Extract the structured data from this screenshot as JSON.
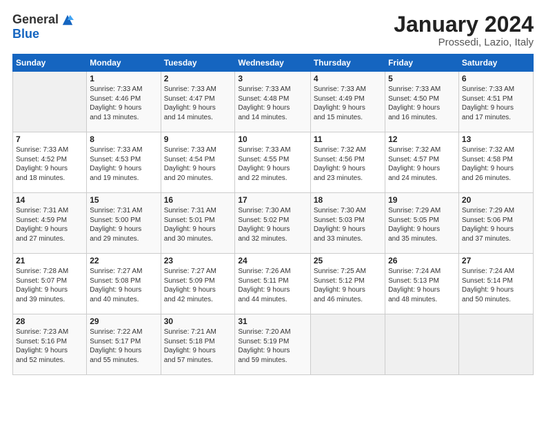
{
  "header": {
    "logo_general": "General",
    "logo_blue": "Blue",
    "title": "January 2024",
    "subtitle": "Prossedi, Lazio, Italy"
  },
  "columns": [
    "Sunday",
    "Monday",
    "Tuesday",
    "Wednesday",
    "Thursday",
    "Friday",
    "Saturday"
  ],
  "weeks": [
    [
      {
        "day": "",
        "info": ""
      },
      {
        "day": "1",
        "info": "Sunrise: 7:33 AM\nSunset: 4:46 PM\nDaylight: 9 hours\nand 13 minutes."
      },
      {
        "day": "2",
        "info": "Sunrise: 7:33 AM\nSunset: 4:47 PM\nDaylight: 9 hours\nand 14 minutes."
      },
      {
        "day": "3",
        "info": "Sunrise: 7:33 AM\nSunset: 4:48 PM\nDaylight: 9 hours\nand 14 minutes."
      },
      {
        "day": "4",
        "info": "Sunrise: 7:33 AM\nSunset: 4:49 PM\nDaylight: 9 hours\nand 15 minutes."
      },
      {
        "day": "5",
        "info": "Sunrise: 7:33 AM\nSunset: 4:50 PM\nDaylight: 9 hours\nand 16 minutes."
      },
      {
        "day": "6",
        "info": "Sunrise: 7:33 AM\nSunset: 4:51 PM\nDaylight: 9 hours\nand 17 minutes."
      }
    ],
    [
      {
        "day": "7",
        "info": "Sunrise: 7:33 AM\nSunset: 4:52 PM\nDaylight: 9 hours\nand 18 minutes."
      },
      {
        "day": "8",
        "info": "Sunrise: 7:33 AM\nSunset: 4:53 PM\nDaylight: 9 hours\nand 19 minutes."
      },
      {
        "day": "9",
        "info": "Sunrise: 7:33 AM\nSunset: 4:54 PM\nDaylight: 9 hours\nand 20 minutes."
      },
      {
        "day": "10",
        "info": "Sunrise: 7:33 AM\nSunset: 4:55 PM\nDaylight: 9 hours\nand 22 minutes."
      },
      {
        "day": "11",
        "info": "Sunrise: 7:32 AM\nSunset: 4:56 PM\nDaylight: 9 hours\nand 23 minutes."
      },
      {
        "day": "12",
        "info": "Sunrise: 7:32 AM\nSunset: 4:57 PM\nDaylight: 9 hours\nand 24 minutes."
      },
      {
        "day": "13",
        "info": "Sunrise: 7:32 AM\nSunset: 4:58 PM\nDaylight: 9 hours\nand 26 minutes."
      }
    ],
    [
      {
        "day": "14",
        "info": "Sunrise: 7:31 AM\nSunset: 4:59 PM\nDaylight: 9 hours\nand 27 minutes."
      },
      {
        "day": "15",
        "info": "Sunrise: 7:31 AM\nSunset: 5:00 PM\nDaylight: 9 hours\nand 29 minutes."
      },
      {
        "day": "16",
        "info": "Sunrise: 7:31 AM\nSunset: 5:01 PM\nDaylight: 9 hours\nand 30 minutes."
      },
      {
        "day": "17",
        "info": "Sunrise: 7:30 AM\nSunset: 5:02 PM\nDaylight: 9 hours\nand 32 minutes."
      },
      {
        "day": "18",
        "info": "Sunrise: 7:30 AM\nSunset: 5:03 PM\nDaylight: 9 hours\nand 33 minutes."
      },
      {
        "day": "19",
        "info": "Sunrise: 7:29 AM\nSunset: 5:05 PM\nDaylight: 9 hours\nand 35 minutes."
      },
      {
        "day": "20",
        "info": "Sunrise: 7:29 AM\nSunset: 5:06 PM\nDaylight: 9 hours\nand 37 minutes."
      }
    ],
    [
      {
        "day": "21",
        "info": "Sunrise: 7:28 AM\nSunset: 5:07 PM\nDaylight: 9 hours\nand 39 minutes."
      },
      {
        "day": "22",
        "info": "Sunrise: 7:27 AM\nSunset: 5:08 PM\nDaylight: 9 hours\nand 40 minutes."
      },
      {
        "day": "23",
        "info": "Sunrise: 7:27 AM\nSunset: 5:09 PM\nDaylight: 9 hours\nand 42 minutes."
      },
      {
        "day": "24",
        "info": "Sunrise: 7:26 AM\nSunset: 5:11 PM\nDaylight: 9 hours\nand 44 minutes."
      },
      {
        "day": "25",
        "info": "Sunrise: 7:25 AM\nSunset: 5:12 PM\nDaylight: 9 hours\nand 46 minutes."
      },
      {
        "day": "26",
        "info": "Sunrise: 7:24 AM\nSunset: 5:13 PM\nDaylight: 9 hours\nand 48 minutes."
      },
      {
        "day": "27",
        "info": "Sunrise: 7:24 AM\nSunset: 5:14 PM\nDaylight: 9 hours\nand 50 minutes."
      }
    ],
    [
      {
        "day": "28",
        "info": "Sunrise: 7:23 AM\nSunset: 5:16 PM\nDaylight: 9 hours\nand 52 minutes."
      },
      {
        "day": "29",
        "info": "Sunrise: 7:22 AM\nSunset: 5:17 PM\nDaylight: 9 hours\nand 55 minutes."
      },
      {
        "day": "30",
        "info": "Sunrise: 7:21 AM\nSunset: 5:18 PM\nDaylight: 9 hours\nand 57 minutes."
      },
      {
        "day": "31",
        "info": "Sunrise: 7:20 AM\nSunset: 5:19 PM\nDaylight: 9 hours\nand 59 minutes."
      },
      {
        "day": "",
        "info": ""
      },
      {
        "day": "",
        "info": ""
      },
      {
        "day": "",
        "info": ""
      }
    ]
  ]
}
